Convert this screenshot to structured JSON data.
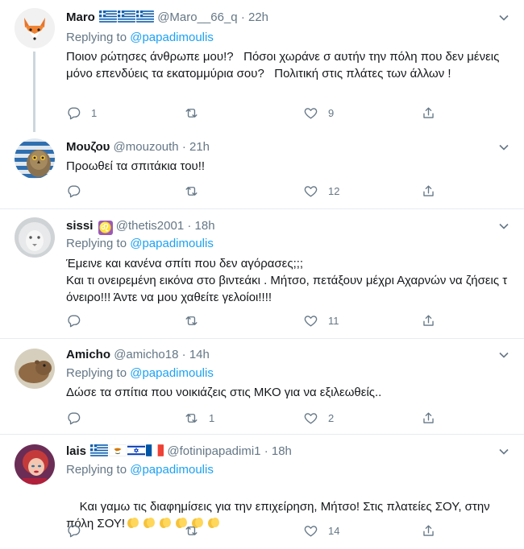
{
  "reply_prefix": "Replying to ",
  "tweets": [
    {
      "name": "Maro",
      "handle": "@Maro__66_q",
      "dot": "·",
      "time": "22h",
      "replying_to": "@papadimoulis",
      "text": "Ποιον ρώτησες άνθρωπε μου!?   Πόσοι χωράνε σ αυτήν την πόλη που δεν μένεις μόνο επενδύεις τα εκατομμύρια σου?   Πολιτική στις πλάτες των άλλων !",
      "counts": {
        "reply": "1",
        "retweet": "",
        "like": "9"
      },
      "flags": [
        "greece",
        "greece",
        "greece"
      ]
    },
    {
      "name": "Μουζου",
      "handle": "@mouzouth",
      "dot": "·",
      "time": "21h",
      "text": "Προωθεί τα σπιτάκια του!!",
      "counts": {
        "reply": "",
        "retweet": "",
        "like": "12"
      }
    },
    {
      "name": "sissi",
      "zodiac": "♌",
      "handle": "@thetis2001",
      "dot": "·",
      "time": "18h",
      "replying_to": "@papadimoulis",
      "text": "Έμεινε και κανένα σπίτι που δεν αγόρασες;;;\nΚαι τι ονειρεμένη εικόνα στο βιντεάκι . Μήτσο, πετάξουν μέχρι Αχαρνών να ζήσεις τ όνειρο!!! Άντε να μου χαθείτε γελοίοι!!!!",
      "counts": {
        "reply": "",
        "retweet": "",
        "like": "11"
      }
    },
    {
      "name": "Amicho",
      "handle": "@amicho18",
      "dot": "·",
      "time": "14h",
      "replying_to": "@papadimoulis",
      "text": "Δώσε τα σπίτια που νοικιάζεις στις ΜΚΟ για να εξιλεωθείς..",
      "counts": {
        "reply": "",
        "retweet": "1",
        "like": "2"
      }
    },
    {
      "name": "lais",
      "handle": "@fotinipapadimi1",
      "dot": "·",
      "time": "18h",
      "replying_to": "@papadimoulis",
      "text": "Και γαμω τις διαφημίσεις για την επιχείρηση, Μήτσο! Στις πλατείες ΣΟΥ, στην πόλη ΣΟΥ!",
      "counts": {
        "reply": "",
        "retweet": "",
        "like": "14"
      },
      "flags": [
        "greece",
        "cyprus",
        "israel",
        "france"
      ]
    }
  ],
  "colors": {
    "accent": "#1da1f2",
    "muted": "#657786",
    "border": "#e6ecf0"
  }
}
